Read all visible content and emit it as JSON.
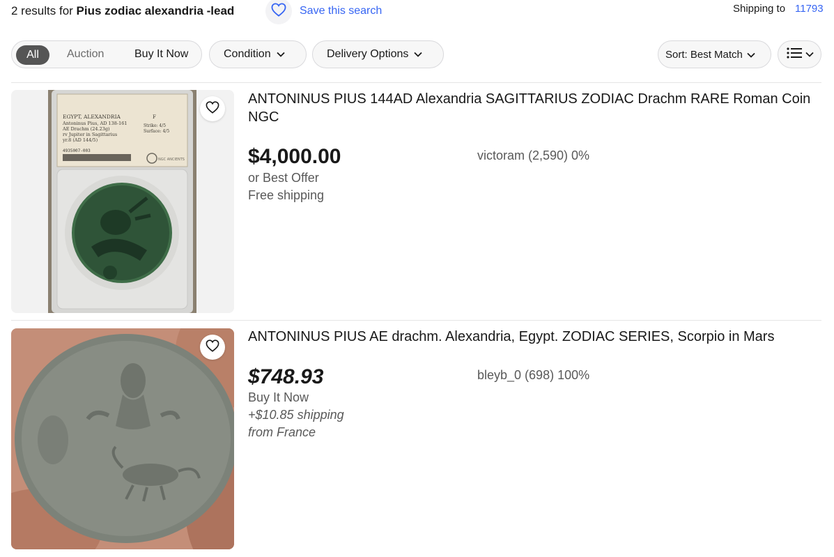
{
  "header": {
    "results_count": "2 results for",
    "query": "Pius zodiac alexandria -lead",
    "save_search": "Save this search",
    "shipping_to_label": "Shipping to",
    "shipping_zip": "11793"
  },
  "filters": {
    "format_all": "All",
    "format_auction": "Auction",
    "format_buy_it_now": "Buy It Now",
    "condition": "Condition",
    "delivery": "Delivery Options",
    "sort": "Sort: Best Match"
  },
  "items": [
    {
      "title": "ANTONINUS PIUS 144AD Alexandria SAGITTARIUS ZODIAC Drachm RARE Roman Coin NGC",
      "price": "$4,000.00",
      "offer": "or Best Offer",
      "shipping": "Free shipping",
      "seller": "victoram (2,590) 0%",
      "slab_label": [
        "EGYPT, ALEXANDRIA",
        "Antoninus Pius, AD 138-161",
        "AE Drachm (24.23g)",
        "rv Jupiter in Sagittarius",
        "yr.8 (AD 144/5)",
        "4935007-003"
      ],
      "slab_grade": [
        "F",
        "Strike: 4/5",
        "Surface: 4/5"
      ],
      "slab_brand": "NGC ANCIENTS"
    },
    {
      "title": "ANTONINUS PIUS AE drachm. Alexandria, Egypt. ZODIAC SERIES, Scorpio in Mars",
      "price": "$748.93",
      "format": "Buy It Now",
      "shipping": "+$10.85 shipping",
      "location": "from France",
      "seller": "bleyb_0 (698) 100%"
    }
  ],
  "colors": {
    "link": "#3665f3",
    "text": "#191919",
    "secondary_text": "#595959",
    "selected_pill": "#555555"
  }
}
